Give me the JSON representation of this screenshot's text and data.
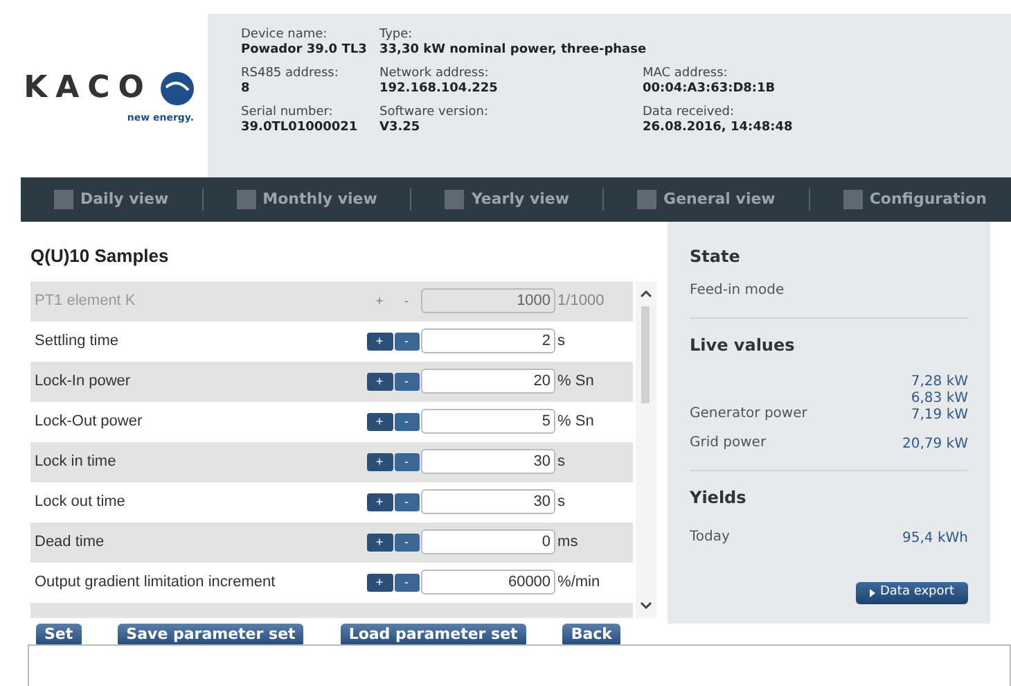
{
  "logo": {
    "wordmark": "KACO",
    "tagline": "new energy."
  },
  "device_info": [
    {
      "label": "Device name:",
      "value": "Powador 39.0 TL3"
    },
    {
      "label": "Type:",
      "value": "33,30 kW nominal power, three-phase"
    },
    {
      "label": "RS485 address:",
      "value": "8"
    },
    {
      "label": "Network address:",
      "value": "192.168.104.225"
    },
    {
      "label": "MAC address:",
      "value": "00:04:A3:63:D8:1B"
    },
    {
      "label": "Serial number:",
      "value": "39.0TL01000021"
    },
    {
      "label": "Software version:",
      "value": "V3.25"
    },
    {
      "label": "Data received:",
      "value": "26.08.2016, 14:48:48"
    }
  ],
  "nav": [
    {
      "label": "Daily view",
      "selected": false
    },
    {
      "label": "Monthly view",
      "selected": false
    },
    {
      "label": "Yearly view",
      "selected": false
    },
    {
      "label": "General view",
      "selected": false
    },
    {
      "label": "Configuration",
      "selected": false
    }
  ],
  "panel_title": "Q(U)10 Samples",
  "parameters": [
    {
      "label": "PT1 element K",
      "plus": "+",
      "minus": "-",
      "value": "1000",
      "unit": "1/1000",
      "disabled": true
    },
    {
      "label": "Settling time",
      "plus": "+",
      "minus": "-",
      "value": "2",
      "unit": "s",
      "disabled": false
    },
    {
      "label": "Lock-In power",
      "plus": "+",
      "minus": "-",
      "value": "20",
      "unit": "% Sn",
      "disabled": false
    },
    {
      "label": "Lock-Out power",
      "plus": "+",
      "minus": "-",
      "value": "5",
      "unit": "% Sn",
      "disabled": false
    },
    {
      "label": "Lock in time",
      "plus": "+",
      "minus": "-",
      "value": "30",
      "unit": "s",
      "disabled": false
    },
    {
      "label": "Lock out time",
      "plus": "+",
      "minus": "-",
      "value": "30",
      "unit": "s",
      "disabled": false
    },
    {
      "label": "Dead time",
      "plus": "+",
      "minus": "-",
      "value": "0",
      "unit": "ms",
      "disabled": false
    },
    {
      "label": "Output gradient limitation increment",
      "plus": "+",
      "minus": "-",
      "value": "60000",
      "unit": "%/min",
      "disabled": false
    }
  ],
  "actions": [
    "Set",
    "Save parameter set",
    "Load parameter set",
    "Back"
  ],
  "sidebar": {
    "state": {
      "title": "State",
      "value": "Feed-in mode"
    },
    "live": {
      "title": "Live values",
      "rows": [
        {
          "label": "Generator power",
          "values": [
            "7,28 kW",
            "6,83 kW",
            "7,19 kW"
          ]
        },
        {
          "label": "Grid power",
          "values": [
            "20,79 kW"
          ]
        }
      ]
    },
    "yields": {
      "title": "Yields",
      "rows": [
        {
          "label": "Today",
          "values": [
            "95,4 kWh"
          ]
        }
      ]
    },
    "export_button": "Data export"
  }
}
